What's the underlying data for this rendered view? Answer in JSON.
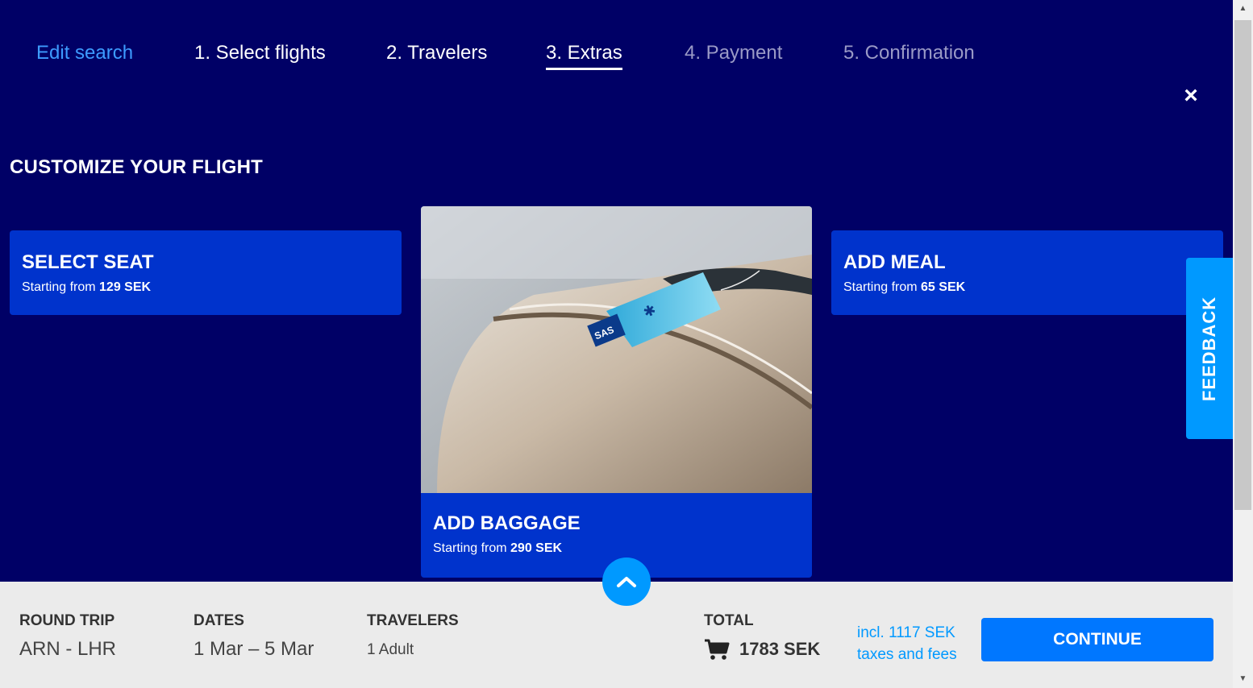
{
  "stepper": {
    "edit_search": "Edit search",
    "steps": [
      {
        "label": "1. Select flights",
        "state": "done"
      },
      {
        "label": "2. Travelers",
        "state": "done"
      },
      {
        "label": "3. Extras",
        "state": "active"
      },
      {
        "label": "4. Payment",
        "state": "upcoming"
      },
      {
        "label": "5. Confirmation",
        "state": "upcoming"
      }
    ],
    "close_icon": "×"
  },
  "page_title": "CUSTOMIZE YOUR FLIGHT",
  "cards": {
    "seat": {
      "title": "SELECT SEAT",
      "sub_prefix": "Starting from ",
      "price": "129 SEK"
    },
    "baggage": {
      "title": "ADD BAGGAGE",
      "sub_prefix": "Starting from ",
      "price": "290 SEK",
      "tag_text": "SAS"
    },
    "meal": {
      "title": "ADD MEAL",
      "sub_prefix": "Starting from ",
      "price": "65 SEK"
    }
  },
  "feedback": {
    "label": "FEEDBACK"
  },
  "footer": {
    "trip_label": "ROUND TRIP",
    "trip_value": "ARN - LHR",
    "dates_label": "DATES",
    "dates_value": "1 Mar – 5 Mar",
    "travelers_label": "TRAVELERS",
    "travelers_value": "1 Adult",
    "total_label": "TOTAL",
    "total_value": "1783 SEK",
    "taxes_line1": "incl. 1117 SEK",
    "taxes_line2": "taxes and fees",
    "continue_label": "CONTINUE"
  },
  "colors": {
    "background": "#000066",
    "card": "#0033cc",
    "accent": "#0099ff",
    "continue": "#0077ff",
    "footer": "#ebebeb"
  }
}
